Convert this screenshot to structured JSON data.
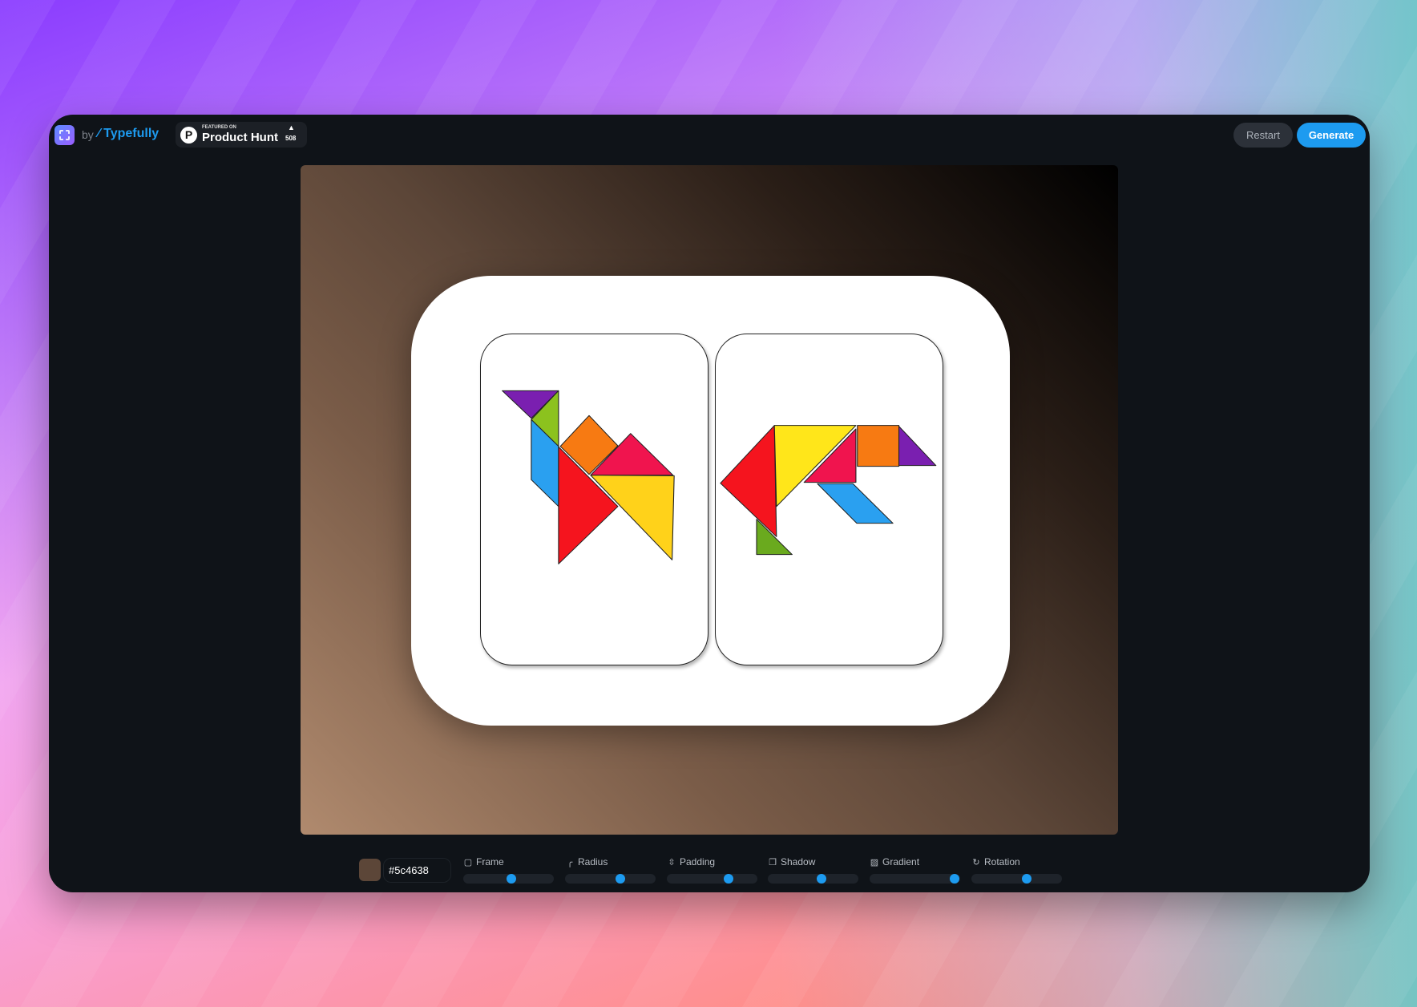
{
  "brand": {
    "by": "by",
    "typefully": "Typefully"
  },
  "product_hunt": {
    "featured": "FEATURED ON",
    "name": "Product Hunt",
    "votes": "508"
  },
  "header": {
    "restart": "Restart",
    "generate": "Generate"
  },
  "toolbar": {
    "color_hex": "#5c4638",
    "controls": [
      {
        "label": "Frame",
        "icon": "frame-icon",
        "value": 0.53
      },
      {
        "label": "Radius",
        "icon": "radius-icon",
        "value": 0.61
      },
      {
        "label": "Padding",
        "icon": "padding-icon",
        "value": 0.68
      },
      {
        "label": "Shadow",
        "icon": "shadow-icon",
        "value": 0.59
      },
      {
        "label": "Gradient",
        "icon": "gradient-icon",
        "value": 0.94
      },
      {
        "label": "Rotation",
        "icon": "rotation-icon",
        "value": 0.61
      }
    ]
  },
  "colors": {
    "accent": "#1d9bf0",
    "background_color": "#5c4638"
  }
}
